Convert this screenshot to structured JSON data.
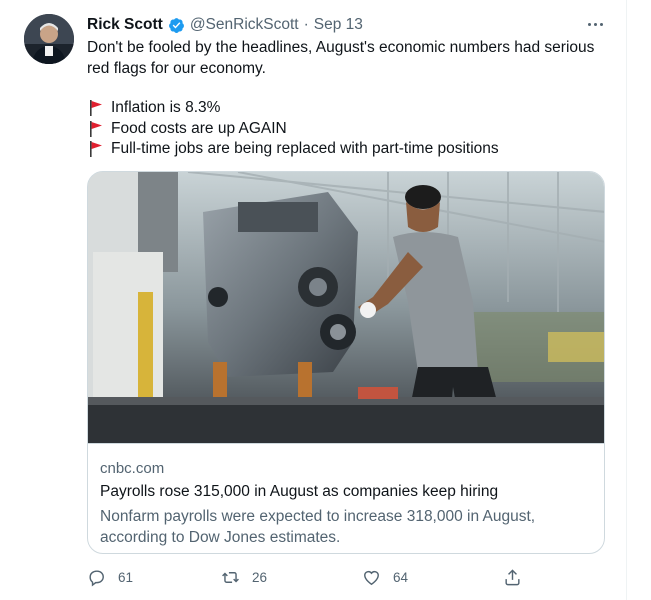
{
  "tweet": {
    "display_name": "Rick Scott",
    "handle": "@SenRickScott",
    "separator": "·",
    "date": "Sep 13",
    "text_lines": [
      "Don't be fooled by the headlines, August's economic numbers had serious",
      "red flags for our economy."
    ],
    "flag_items": [
      "Inflation is 8.3%",
      "Food costs are up AGAIN",
      "Full-time jobs are being replaced with part-time positions"
    ]
  },
  "card": {
    "domain": "cnbc.com",
    "title": "Payrolls rose 315,000 in August as companies keep hiring",
    "description": "Nonfarm payrolls were expected to increase 318,000 in August, according to Dow Jones estimates."
  },
  "actions": {
    "reply_count": "61",
    "retweet_count": "26",
    "like_count": "64"
  },
  "colors": {
    "verified": "#1d9bf0",
    "secondary_text": "#536471",
    "flag_red": "#e0202f"
  },
  "icons": [
    "verified-badge-icon",
    "more-icon",
    "red-flag-icon",
    "reply-icon",
    "retweet-icon",
    "like-icon",
    "share-icon"
  ]
}
